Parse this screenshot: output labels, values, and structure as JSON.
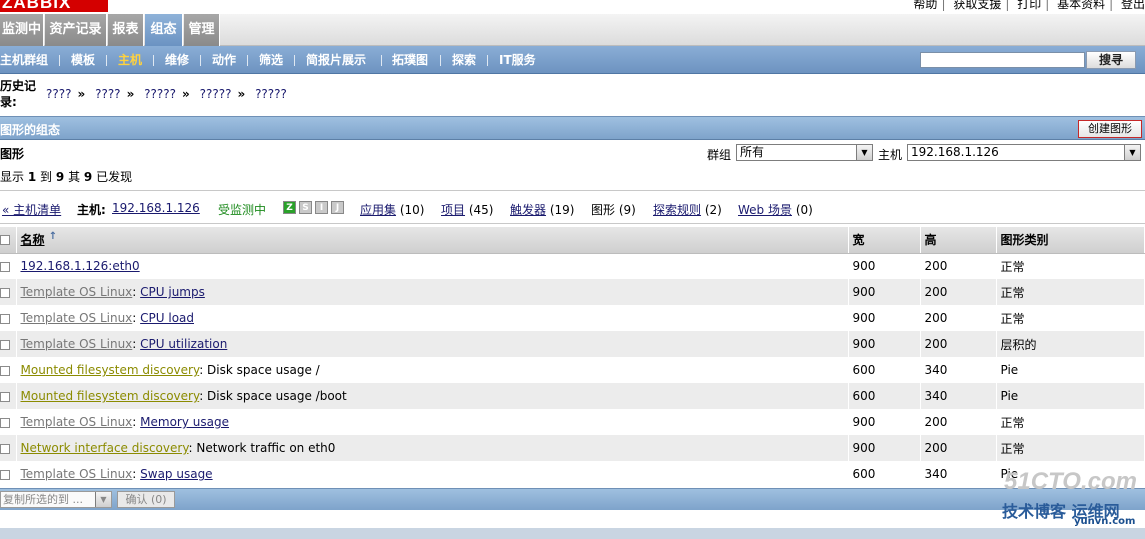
{
  "top": {
    "logo": "ZABBIX",
    "links": [
      "帮助",
      "获取支援",
      "打印",
      "基本资料",
      "登出"
    ]
  },
  "main_menu": [
    {
      "label": "监测中",
      "active": false
    },
    {
      "label": "资产记录",
      "active": false
    },
    {
      "label": "报表",
      "active": false
    },
    {
      "label": "组态",
      "active": true
    },
    {
      "label": "管理",
      "active": false
    }
  ],
  "sub_menu": [
    {
      "label": "主机群组",
      "active": false
    },
    {
      "label": "模板",
      "active": false
    },
    {
      "label": "主机",
      "active": true
    },
    {
      "label": "维修",
      "active": false
    },
    {
      "label": "动作",
      "active": false
    },
    {
      "label": "筛选",
      "active": false
    },
    {
      "label": "简报片展示",
      "active": false
    },
    {
      "label": "拓璞图",
      "active": false
    },
    {
      "label": "探索",
      "active": false
    },
    {
      "label": "IT服务",
      "active": false
    }
  ],
  "search": {
    "value": "",
    "button": "搜寻"
  },
  "history": {
    "label": "历史记录:",
    "crumbs": [
      "????",
      "????",
      "?????",
      "?????",
      "?????"
    ]
  },
  "section": {
    "title": "图形的组态",
    "create_button": "创建图形"
  },
  "filter": {
    "title": "图形",
    "group_label": "群组",
    "group_value": "所有",
    "host_label": "主机",
    "host_value": "192.168.1.126"
  },
  "found": {
    "prefix": "显示",
    "from": "1",
    "to_word": "到",
    "to": "9",
    "of_word": "其",
    "total": "9",
    "suffix": "已发现"
  },
  "hostbar": {
    "host_list": "« 主机清单",
    "host_label": "主机:",
    "host_name": "192.168.1.126",
    "status": "受监测中",
    "avail": [
      "Z",
      "S",
      "I",
      "J"
    ],
    "applications": "应用集",
    "applications_count": "(10)",
    "items": "项目",
    "items_count": "(45)",
    "triggers": "触发器",
    "triggers_count": "(19)",
    "graphs": "图形",
    "graphs_count": "(9)",
    "discovery": "探索规则",
    "discovery_count": "(2)",
    "web": "Web 场景",
    "web_count": "(0)"
  },
  "table": {
    "columns": [
      "名称",
      "宽",
      "高",
      "图形类别"
    ],
    "rows": [
      {
        "prefix": "",
        "prefix_type": "",
        "name": "192.168.1.126:eth0",
        "name_link": true,
        "width": "900",
        "height": "200",
        "type": "正常"
      },
      {
        "prefix": "Template OS Linux",
        "prefix_type": "tpl",
        "name": "CPU jumps",
        "name_link": true,
        "width": "900",
        "height": "200",
        "type": "正常"
      },
      {
        "prefix": "Template OS Linux",
        "prefix_type": "tpl",
        "name": "CPU load",
        "name_link": true,
        "width": "900",
        "height": "200",
        "type": "正常"
      },
      {
        "prefix": "Template OS Linux",
        "prefix_type": "tpl",
        "name": "CPU utilization",
        "name_link": true,
        "width": "900",
        "height": "200",
        "type": "层积的"
      },
      {
        "prefix": "Mounted filesystem discovery",
        "prefix_type": "disc",
        "name": "Disk space usage /",
        "name_link": false,
        "width": "600",
        "height": "340",
        "type": "Pie"
      },
      {
        "prefix": "Mounted filesystem discovery",
        "prefix_type": "disc",
        "name": "Disk space usage /boot",
        "name_link": false,
        "width": "600",
        "height": "340",
        "type": "Pie"
      },
      {
        "prefix": "Template OS Linux",
        "prefix_type": "tpl",
        "name": "Memory usage",
        "name_link": true,
        "width": "900",
        "height": "200",
        "type": "正常"
      },
      {
        "prefix": "Network interface discovery",
        "prefix_type": "disc",
        "name": "Network traffic on eth0",
        "name_link": false,
        "width": "900",
        "height": "200",
        "type": "正常"
      },
      {
        "prefix": "Template OS Linux",
        "prefix_type": "tpl",
        "name": "Swap usage",
        "name_link": true,
        "width": "600",
        "height": "340",
        "type": "Pie"
      }
    ]
  },
  "footer": {
    "copy_select": "复制所选的到 ...",
    "confirm_button": "确认 (0)"
  },
  "watermark": {
    "top": "51CTO.com",
    "bottom": "技术博客 运维网",
    "url": "yunvn.com"
  }
}
